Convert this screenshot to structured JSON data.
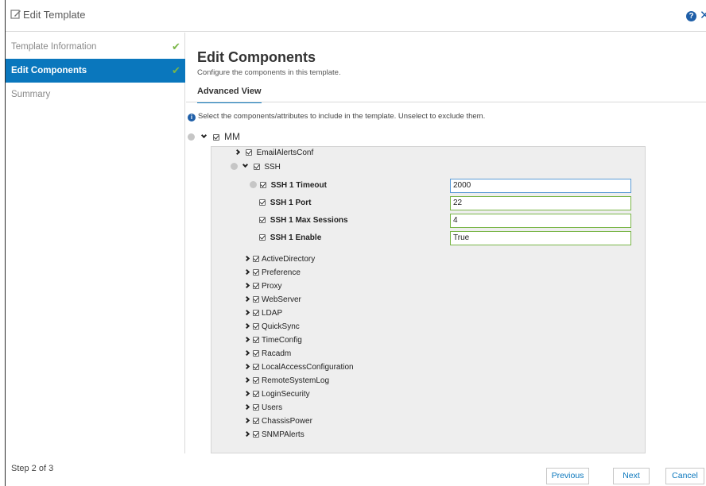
{
  "window": {
    "title": "Edit Template",
    "help_icon": "help-icon",
    "close_icon": "close-icon"
  },
  "sidebar": {
    "steps": [
      {
        "label": "Template Information",
        "completed": true
      },
      {
        "label": "Edit Components",
        "completed": true,
        "active": true
      },
      {
        "label": "Summary",
        "completed": false
      }
    ],
    "footer": "Step 2 of 3"
  },
  "main": {
    "title": "Edit Components",
    "subtitle": "Configure the components in this template.",
    "tab": "Advanced View",
    "info": "Select the components/attributes to include in the template. Unselect to exclude them.",
    "root": "MM",
    "tree": {
      "email": "EmailAlertsConf",
      "ssh": "SSH",
      "ssh_attrs": [
        {
          "label": "SSH 1 Timeout",
          "value": "2000"
        },
        {
          "label": "SSH 1 Port",
          "value": "22"
        },
        {
          "label": "SSH 1 Max Sessions",
          "value": "4"
        },
        {
          "label": "SSH 1 Enable",
          "value": "True"
        }
      ],
      "components": [
        "ActiveDirectory",
        "Preference",
        "Proxy",
        "WebServer",
        "LDAP",
        "QuickSync",
        "TimeConfig",
        "Racadm",
        "LocalAccessConfiguration",
        "RemoteSystemLog",
        "LoginSecurity",
        "Users",
        "ChassisPower",
        "SNMPAlerts"
      ]
    }
  },
  "footer_buttons": {
    "previous": "Previous",
    "next": "Next",
    "cancel": "Cancel"
  },
  "colors": {
    "accent": "#0a77bd",
    "check": "#7ab648",
    "panel": "#eeeeee"
  }
}
